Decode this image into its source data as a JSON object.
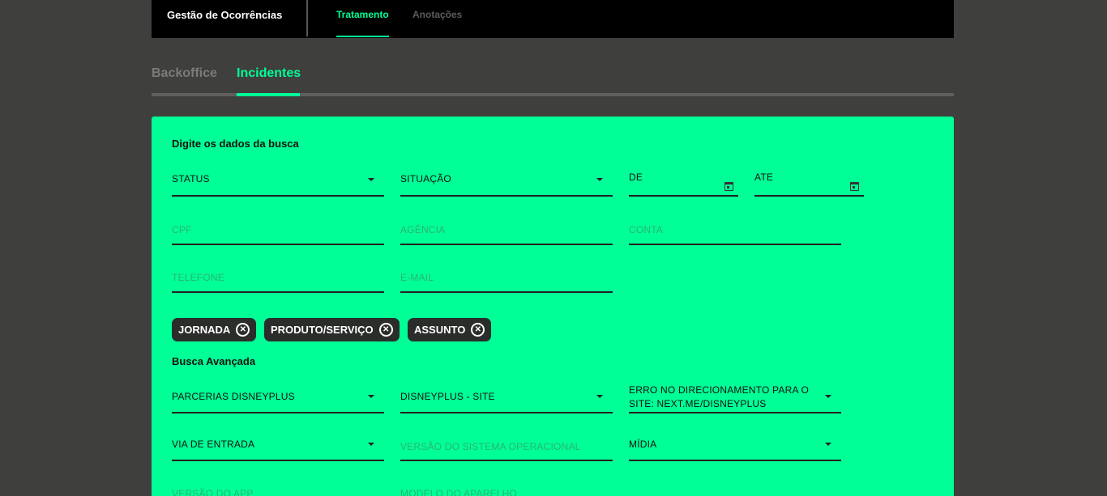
{
  "header": {
    "app_title": "Gestão de Ocorrências",
    "tabs": [
      {
        "label": "Tratamento",
        "active": true
      },
      {
        "label": "Anotações",
        "active": false
      }
    ]
  },
  "subtabs": [
    {
      "label": "Backoffice",
      "active": false
    },
    {
      "label": "Incidentes",
      "active": true
    }
  ],
  "colors": {
    "accent": "#00ff96",
    "background": "#3f3f3d",
    "topbar": "#000000",
    "chip": "#2b2d2b"
  },
  "search": {
    "title": "Digite os dados da busca",
    "status": {
      "value": "STATUS",
      "icon": "chevron-down-icon"
    },
    "situacao": {
      "value": "SITUAÇÃO",
      "icon": "chevron-down-icon"
    },
    "de": {
      "label": "DE",
      "icon": "calendar-icon"
    },
    "ate": {
      "label": "ATE",
      "icon": "calendar-icon"
    },
    "cpf": {
      "placeholder": "CPF"
    },
    "agencia": {
      "placeholder": "AGÊNCIA"
    },
    "conta": {
      "placeholder": "CONTA"
    },
    "telefone": {
      "placeholder": "TELEFONE"
    },
    "email": {
      "placeholder": "E-MAIL"
    },
    "chips": [
      {
        "label": "JORNADA",
        "icon": "close-circle-icon"
      },
      {
        "label": "PRODUTO/SERVIÇO",
        "icon": "close-circle-icon"
      },
      {
        "label": "ASSUNTO",
        "icon": "close-circle-icon"
      }
    ]
  },
  "advanced": {
    "title": "Busca Avançada",
    "jornada": {
      "value": "PARCERIAS DISNEYPLUS"
    },
    "produto": {
      "value": "DISNEYPLUS - SITE"
    },
    "assunto": {
      "value_line1": "ERRO NO DIRECIONAMENTO PARA O",
      "value_line2": "SITE: NEXT.ME/DISNEYPLUS"
    },
    "via_entrada": {
      "value": "VIA DE ENTRADA"
    },
    "versao_so": {
      "placeholder": "VERSÃO DO SISTEMA OPERACIONAL"
    },
    "midia": {
      "value": "MÍDIA"
    },
    "versao_app": {
      "placeholder": "VERSÃO DO APP"
    },
    "modelo_aparelho": {
      "placeholder": "MODELO DO APARELHO"
    }
  }
}
